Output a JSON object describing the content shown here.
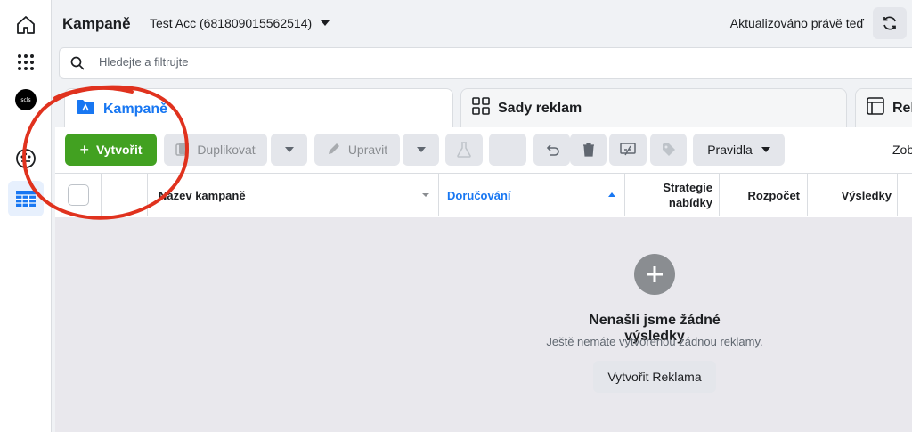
{
  "header": {
    "title": "Kampaně",
    "account": "Test Acc (681809015562514)",
    "updated": "Aktualizováno právě teď"
  },
  "rail": {
    "avatar_text": "scls"
  },
  "search": {
    "placeholder": "Hledejte a filtrujte"
  },
  "tabs": [
    {
      "label": "Kampaně",
      "active": true
    },
    {
      "label": "Sady reklam",
      "active": false
    },
    {
      "label": "Rek",
      "active": false
    }
  ],
  "toolbar": {
    "create": "Vytvořit",
    "duplicate": "Duplikovat",
    "edit": "Upravit",
    "rules": "Pravidla",
    "view": "Zob"
  },
  "table": {
    "columns": [
      "Název kampaně",
      "Doručování",
      "Strategie nabídky",
      "Rozpočet",
      "Výsledky"
    ]
  },
  "empty": {
    "title": "Nenašli jsme žádné výsledky",
    "subtitle": "Ještě nemáte vytvořenou žádnou reklamy.",
    "button": "Vytvořit Reklama"
  },
  "colors": {
    "accent": "#1877f2",
    "create": "#42a121",
    "annotation": "#e0321e"
  }
}
